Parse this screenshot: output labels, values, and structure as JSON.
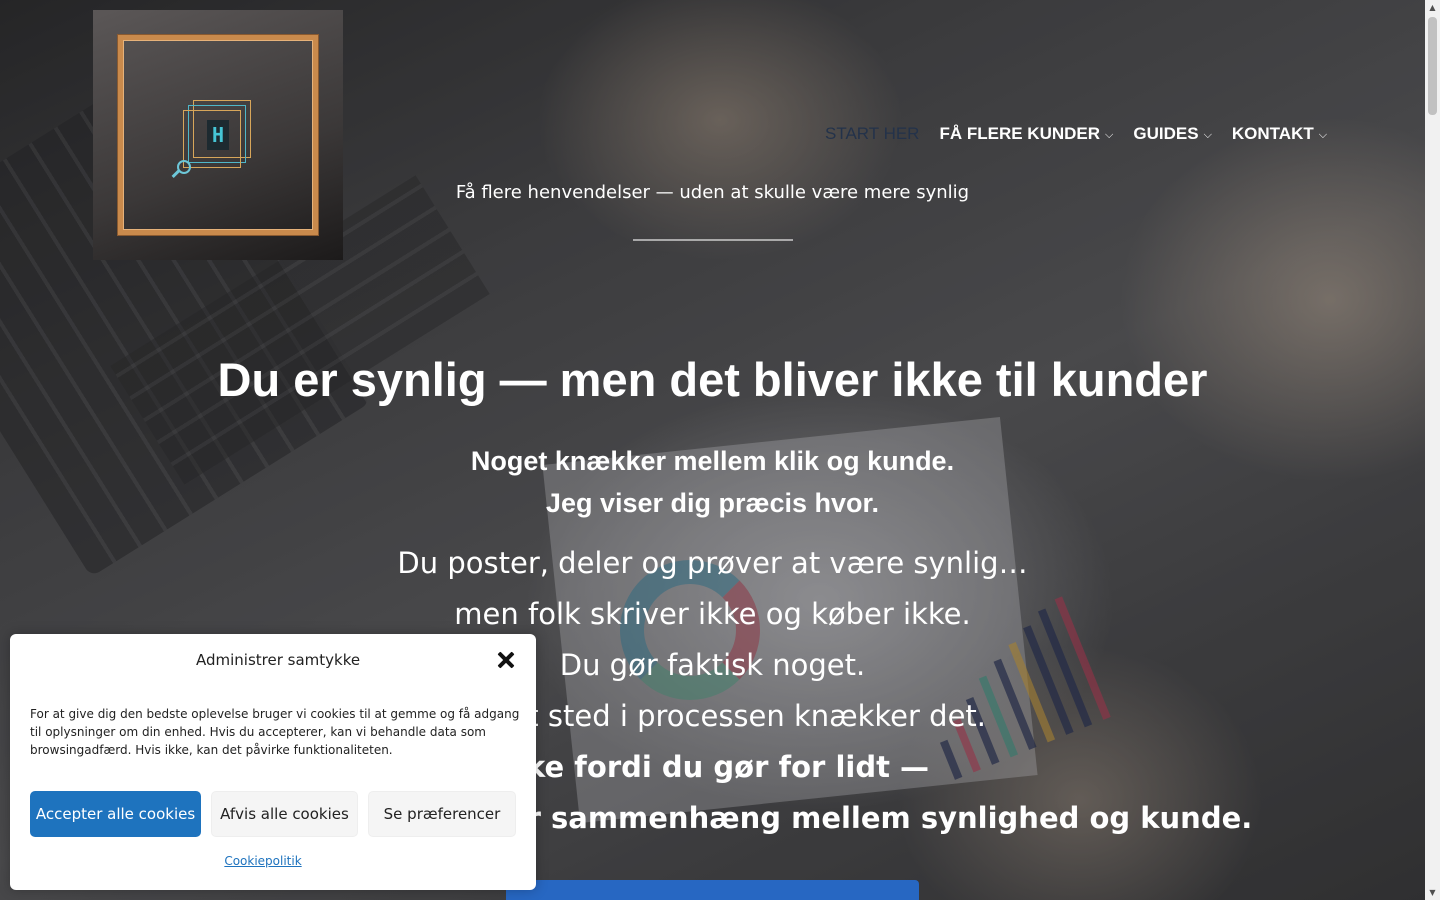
{
  "logo": {
    "letter": "H"
  },
  "nav": {
    "items": [
      {
        "label": "START HER",
        "active": true,
        "has_dropdown": false
      },
      {
        "label": "FÅ FLERE KUNDER",
        "active": false,
        "has_dropdown": true
      },
      {
        "label": "GUIDES",
        "active": false,
        "has_dropdown": true
      },
      {
        "label": "KONTAKT",
        "active": false,
        "has_dropdown": true
      }
    ],
    "chevron": "⌵"
  },
  "header": {
    "tagline": "Få flere henvendelser — uden at skulle være mere synlig"
  },
  "hero": {
    "title": "Du er synlig — men det bliver ikke til kunder",
    "subtitle_line1": "Noget knækker mellem klik og kunde.",
    "subtitle_line2": "Jeg viser dig præcis hvor.",
    "body_lines": [
      "Du poster, deler og prøver at være synlig…",
      "men folk skriver ikke og køber ikke.",
      "Du gør faktisk noget.",
      "Men et sted i processen knækker det.",
      "Ikke fordi du gør for lidt —",
      "men fordi der mangler sammenhæng mellem synlighed og kunde."
    ]
  },
  "cookie_dialog": {
    "title": "Administrer samtykke",
    "text": "For at give dig den bedste oplevelse bruger vi cookies til at gemme og få adgang til oplysninger om din enhed. Hvis du accepterer, kan vi behandle data som browsingadfærd. Hvis ikke, kan det påvirke funktionaliteten.",
    "accept_label": "Accepter alle cookies",
    "deny_label": "Afvis alle cookies",
    "preferences_label": "Se præferencer",
    "policy_link": "Cookiepolitik"
  },
  "colors": {
    "accent": "#1e73be",
    "cta": "#2767c2",
    "active_nav": "#23324a",
    "logo_frame": "#c98a4c",
    "logo_teal": "#46c6d6"
  },
  "icons": {
    "close": "close-icon",
    "chevron": "chevron-down-icon",
    "magnifier": "magnifier-icon"
  }
}
